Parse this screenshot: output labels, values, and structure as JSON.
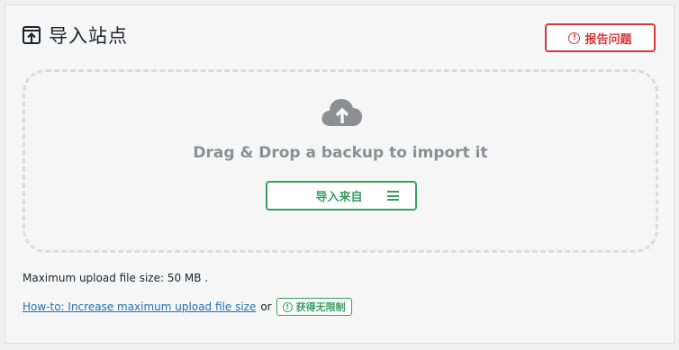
{
  "header": {
    "title": "导入站点",
    "icon": "import-icon"
  },
  "report_button": {
    "label": "报告问题",
    "icon": "exclamation-circle-icon",
    "color": "#d63638"
  },
  "dropzone": {
    "icon": "cloud-upload-icon",
    "text": "Drag & Drop a backup to import it",
    "import_button": {
      "label": "导入来自",
      "icon": "hamburger-menu-icon",
      "color": "#3a9e62"
    }
  },
  "footer": {
    "max_upload": "Maximum upload file size: 50 MB .",
    "howto_link": "How-to: Increase maximum upload file size",
    "or_text": "or",
    "unlimited_badge": {
      "label": "获得无限制",
      "icon": "exclamation-circle-icon",
      "color": "#3a9e62"
    }
  }
}
